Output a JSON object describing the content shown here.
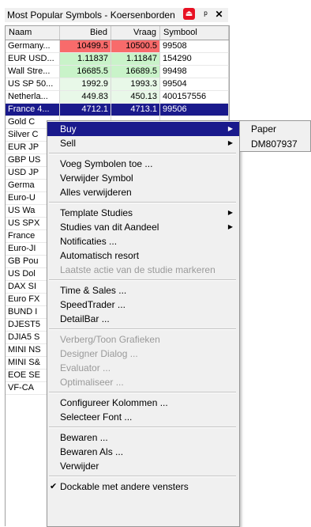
{
  "window": {
    "title": "Most Popular Symbols - Koersenborden",
    "pin_glyph": "ᵖ",
    "close_glyph": "✕",
    "status_glyph": "⏏"
  },
  "table": {
    "columns": [
      "Naam",
      "Bied",
      "Vraag",
      "Symbool"
    ],
    "rows": [
      {
        "naam": "Germany...",
        "bied": "10499.5",
        "vraag": "10500.5",
        "symbool": "99508",
        "style": "red"
      },
      {
        "naam": "EUR USD...",
        "bied": "1.11837",
        "vraag": "1.11847",
        "symbool": "154290",
        "style": "green"
      },
      {
        "naam": "Wall Stre...",
        "bied": "16685.5",
        "vraag": "16689.5",
        "symbool": "99498",
        "style": "green"
      },
      {
        "naam": "US SP 50...",
        "bied": "1992.9",
        "vraag": "1993.3",
        "symbool": "99504",
        "style": "light"
      },
      {
        "naam": "Netherla...",
        "bied": "449.83",
        "vraag": "450.13",
        "symbool": "400157556",
        "style": "light"
      },
      {
        "naam": "France 4...",
        "bied": "4712.1",
        "vraag": "4713.1",
        "symbool": "99506",
        "style": "selected"
      },
      {
        "naam": "Gold C",
        "bied": "",
        "vraag": "",
        "symbool": "",
        "style": "none"
      },
      {
        "naam": "Silver C",
        "bied": "",
        "vraag": "",
        "symbool": "",
        "style": "none"
      },
      {
        "naam": "EUR JP",
        "bied": "",
        "vraag": "",
        "symbool": "",
        "style": "none"
      },
      {
        "naam": "GBP US",
        "bied": "",
        "vraag": "",
        "symbool": "",
        "style": "none"
      },
      {
        "naam": "USD JP",
        "bied": "",
        "vraag": "",
        "symbool": "",
        "style": "none"
      },
      {
        "naam": "Germa",
        "bied": "",
        "vraag": "",
        "symbool": "",
        "style": "none"
      },
      {
        "naam": "Euro-U",
        "bied": "",
        "vraag": "",
        "symbool": "",
        "style": "none"
      },
      {
        "naam": "US Wa",
        "bied": "",
        "vraag": "",
        "symbool": "",
        "style": "none"
      },
      {
        "naam": "US SPX",
        "bied": "",
        "vraag": "",
        "symbool": "",
        "style": "none"
      },
      {
        "naam": "France",
        "bied": "",
        "vraag": "",
        "symbool": "",
        "style": "none"
      },
      {
        "naam": "Euro-JI",
        "bied": "",
        "vraag": "",
        "symbool": "",
        "style": "none"
      },
      {
        "naam": "GB Pou",
        "bied": "",
        "vraag": "",
        "symbool": "",
        "style": "none"
      },
      {
        "naam": "US Dol",
        "bied": "",
        "vraag": "",
        "symbool": "",
        "style": "none"
      },
      {
        "naam": "DAX SI",
        "bied": "",
        "vraag": "",
        "symbool": "",
        "style": "none"
      },
      {
        "naam": "Euro FX",
        "bied": "",
        "vraag": "",
        "symbool": "",
        "style": "none"
      },
      {
        "naam": "BUND I",
        "bied": "",
        "vraag": "",
        "symbool": "",
        "style": "none"
      },
      {
        "naam": "DJEST5",
        "bied": "",
        "vraag": "",
        "symbool": "",
        "style": "none"
      },
      {
        "naam": "DJIA5 S",
        "bied": "",
        "vraag": "",
        "symbool": "",
        "style": "none"
      },
      {
        "naam": "MINI NS",
        "bied": "",
        "vraag": "",
        "symbool": "",
        "style": "none"
      },
      {
        "naam": "MINI S&",
        "bied": "",
        "vraag": "",
        "symbool": "",
        "style": "none"
      },
      {
        "naam": "EOE SE",
        "bied": "",
        "vraag": "",
        "symbool": "",
        "style": "none"
      },
      {
        "naam": "VF-CA",
        "bied": "",
        "vraag": "",
        "symbool": "",
        "style": "none"
      }
    ]
  },
  "context_menu": {
    "items": [
      {
        "label": "Buy",
        "type": "submenu",
        "state": "highlighted"
      },
      {
        "label": "Sell",
        "type": "submenu",
        "state": "normal"
      },
      {
        "type": "separator"
      },
      {
        "label": "Voeg Symbolen toe ...",
        "type": "item",
        "state": "normal"
      },
      {
        "label": "Verwijder Symbol",
        "type": "item",
        "state": "normal"
      },
      {
        "label": "Alles verwijderen",
        "type": "item",
        "state": "normal"
      },
      {
        "type": "separator"
      },
      {
        "label": "Template Studies",
        "type": "submenu",
        "state": "normal"
      },
      {
        "label": "Studies van dit Aandeel",
        "type": "submenu",
        "state": "normal"
      },
      {
        "label": "Notificaties ...",
        "type": "item",
        "state": "normal"
      },
      {
        "label": "Automatisch resort",
        "type": "item",
        "state": "normal"
      },
      {
        "label": "Laatste actie van de studie markeren",
        "type": "item",
        "state": "disabled"
      },
      {
        "type": "separator"
      },
      {
        "label": "Time & Sales ...",
        "type": "item",
        "state": "normal"
      },
      {
        "label": "SpeedTrader ...",
        "type": "item",
        "state": "normal"
      },
      {
        "label": "DetailBar ...",
        "type": "item",
        "state": "normal"
      },
      {
        "type": "separator"
      },
      {
        "label": "Verberg/Toon Grafieken",
        "type": "item",
        "state": "disabled"
      },
      {
        "label": "Designer Dialog ...",
        "type": "item",
        "state": "disabled"
      },
      {
        "label": "Evaluator ...",
        "type": "item",
        "state": "disabled"
      },
      {
        "label": "Optimaliseer ...",
        "type": "item",
        "state": "disabled"
      },
      {
        "type": "separator"
      },
      {
        "label": "Configureer Kolommen ...",
        "type": "item",
        "state": "normal"
      },
      {
        "label": "Selecteer Font ...",
        "type": "item",
        "state": "normal"
      },
      {
        "type": "separator"
      },
      {
        "label": "Bewaren ...",
        "type": "item",
        "state": "normal"
      },
      {
        "label": "Bewaren Als ...",
        "type": "item",
        "state": "normal"
      },
      {
        "label": "Verwijder",
        "type": "item",
        "state": "normal"
      },
      {
        "type": "separator"
      },
      {
        "label": "Dockable met andere vensters",
        "type": "item",
        "state": "checked"
      }
    ],
    "arrow_glyph": "▶",
    "check_glyph": "✔"
  },
  "submenu": {
    "items": [
      "Paper",
      "DM807937"
    ]
  },
  "colors": {
    "selection": "#1a1a8c",
    "bid_red": "#f86b6b",
    "bid_green": "#c9f3c9",
    "menu_bg": "#f0f0f0"
  }
}
